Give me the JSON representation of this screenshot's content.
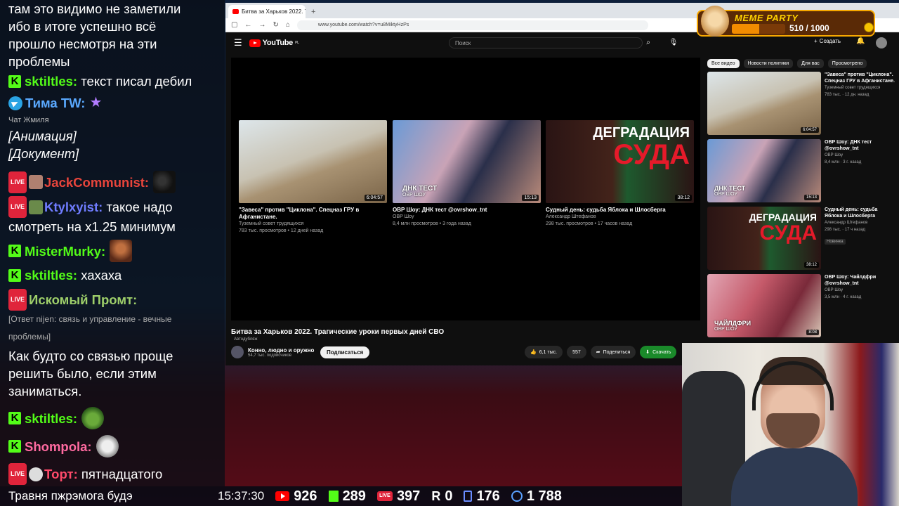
{
  "chat": {
    "lines": [
      {
        "text": "там это видимо не заметили"
      },
      {
        "text": "ибо в итоге успешно всё"
      },
      {
        "text": "прошло несмотря на эти"
      },
      {
        "text": "проблемы"
      }
    ],
    "m1_nick": "sktiltles:",
    "m1_text": "текст писал дебил",
    "m1_color": "#53fc18",
    "m2_nick": "Тима TW:",
    "m2_color": "#5aa9ff",
    "sys_label": "Чат Жмиля",
    "italic1": "[Анимация]",
    "italic2": "[Документ]",
    "m3_nick": "JackCommunist:",
    "m3_color": "#e8453c",
    "m4_nick": "Ktylxyist:",
    "m4_text": "такое надо",
    "m4_color": "#6f7cff",
    "m4_cont": "смотреть на x1.25 минимум",
    "m5_nick": "MisterMurky:",
    "m5_color": "#53fc18",
    "m6_nick": "sktiltles:",
    "m6_text": "хахаха",
    "m7_nick": "Искомый Промт:",
    "m7_color": "#9ecf6a",
    "reply1": "[Ответ nijen: связь и управление - вечные",
    "reply2": "проблемы]",
    "m7_text1": "Как будто со связью проще",
    "m7_text2": "решить было, если этим",
    "m7_text3": "заниматься.",
    "m8_nick": "sktiltles:",
    "m9_nick": "Shompola:",
    "m9_color": "#ff6aa0",
    "m10_nick": "Торт:",
    "m10_text": "пятнадцатого",
    "m10_color": "#ff4a6a",
    "live_label": "LIVE",
    "k_label": "K"
  },
  "browser": {
    "tab_title": "Битва за Харьков 2022. Траги",
    "tab_close": "×",
    "tab_new": "+",
    "url": "www.youtube.com/watch?v=u8MiktyHzPs"
  },
  "youtube": {
    "logo": "YouTube",
    "logo_region": "PL",
    "search_placeholder": "Поиск",
    "create_label": "Создать",
    "endcards": [
      {
        "title": "\"Завеса\" против \"Циклона\". Спецназ ГРУ в Афганистане.",
        "channel": "Туземный совет трудящихся",
        "stats": "783 тыс. просмотров • 12 дней назад",
        "duration": "6:04:57"
      },
      {
        "title": "ОВР Шоу: ДНК тест @ovrshow_tnt",
        "channel": "ОВР Шоу",
        "stats": "8,4 млн просмотров • 3 года назад",
        "duration": "15:13",
        "overlay_title": "ДНК ТЕСТ",
        "overlay_sub": "ОВР ШОУ"
      },
      {
        "title": "Судный день: судьба Яблока и Шлосберга",
        "channel": "Александр Штефанов",
        "stats": "298 тыс. просмотров • 17 часов назад",
        "duration": "38:12",
        "overlay_top": "ДЕГРАДАЦИЯ",
        "overlay_big": "СУДА"
      }
    ],
    "video_title": "Битва за Харьков 2022. Трагические уроки первых дней СВО",
    "autodub": "Автодубляж",
    "channel_name": "Конно, людно и оружно",
    "channel_subs": "54,7 тыс. подписчиков",
    "subscribe": "Подписаться",
    "likes": "6,1 тыс.",
    "comments": "557",
    "share": "Поделиться",
    "download": "Скачать",
    "chips": [
      "Все видео",
      "Новости политики",
      "Для вас",
      "Просмотрено"
    ],
    "sidebar": [
      {
        "title": "\"Завеса\" против \"Циклона\". Спецназ ГРУ в Афганистане.",
        "channel": "Туземный совет трудящихся",
        "stats": "783 тыс. · 12 дн. назад",
        "duration": "6:04:57"
      },
      {
        "title": "ОВР Шоу: ДНК тест @ovrshow_tnt",
        "channel": "ОВР Шоу",
        "stats": "8,4 млн · 3 г. назад",
        "duration": "15:13"
      },
      {
        "title": "Судный день: судьба Яблока и Шлосберга",
        "channel": "Александр Штефанов",
        "stats": "298 тыс. · 17 ч назад",
        "duration": "38:12",
        "badge": "Новинка"
      },
      {
        "title": "ОВР Шоу: Чайлдфри @ovrshow_tnt",
        "channel": "ОВР Шоу",
        "stats": "3,5 млн · 4 г. назад",
        "duration": "8:08",
        "overlay_title": "ЧАЙЛДФРИ",
        "overlay_sub": "ОВР ШОУ"
      }
    ]
  },
  "meme_party": {
    "title": "MEME PARTY",
    "score": "510 / 1000",
    "progress": 0.51
  },
  "stats": {
    "ticker": "Травня пжрэмога будэ",
    "time": "15:37:30",
    "youtube": "926",
    "kick": "289",
    "vk": "397",
    "rutube": "0",
    "other": "176",
    "total": "1 788"
  }
}
